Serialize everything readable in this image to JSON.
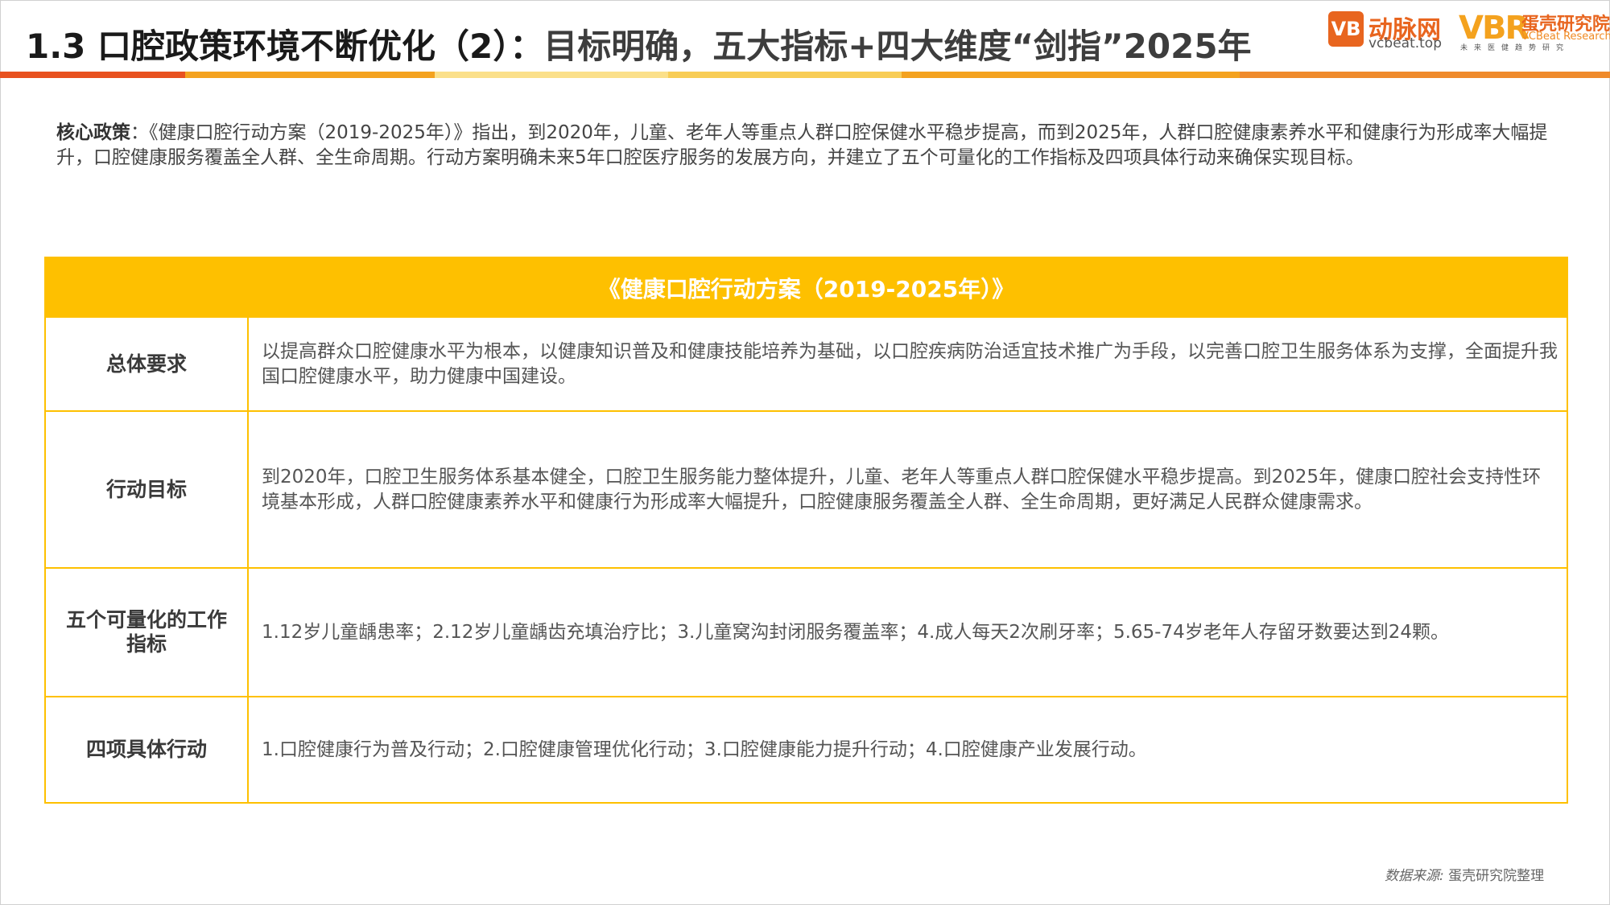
{
  "header": {
    "title_main": "1.3 口腔政策环境不断优化（2）",
    "title_sep": "：",
    "title_sub": "目标明确，五大指标+四大维度“剑指”2025年"
  },
  "logos": {
    "vb_mark": "VB",
    "dongmai_name": "动脉网",
    "dongmai_url": "vcbeat.top",
    "vbr_mark": "VBR",
    "danke_name": "蛋壳研究院",
    "danke_en": "VCBeat Research",
    "danke_slogan": "未来医健趋势研究"
  },
  "accent_colors": [
    "#e8511f",
    "#f4a21e",
    "#fbe08a",
    "#f8cd56",
    "#f4a21e",
    "#ef8a2b"
  ],
  "core_policy": {
    "label": "核心政策",
    "separator": "：",
    "text": "《健康口腔行动方案（2019-2025年）》指出，到2020年，儿童、老年人等重点人群口腔保健水平稳步提高，而到2025年，人群口腔健康素养水平和健康行为形成率大幅提升，口腔健康服务覆盖全人群、全生命周期。行动方案明确未来5年口腔医疗服务的发展方向，并建立了五个可量化的工作指标及四项具体行动来确保实现目标。"
  },
  "table": {
    "title": "《健康口腔行动方案（2019-2025年）》",
    "rows": [
      {
        "key": "总体要求",
        "value": "以提高群众口腔健康水平为根本，以健康知识普及和健康技能培养为基础，以口腔疾病防治适宜技术推广为手段，以完善口腔卫生服务体系为支撑，全面提升我国口腔健康水平，助力健康中国建设。"
      },
      {
        "key": "行动目标",
        "value": "到2020年，口腔卫生服务体系基本健全，口腔卫生服务能力整体提升，儿童、老年人等重点人群口腔保健水平稳步提高。到2025年，健康口腔社会支持性环境基本形成，人群口腔健康素养水平和健康行为形成率大幅提升，口腔健康服务覆盖全人群、全生命周期，更好满足人民群众健康需求。"
      },
      {
        "key": "五个可量化的工作指标",
        "value": "1.12岁儿童龋患率；2.12岁儿童龋齿充填治疗比；3.儿童窝沟封闭服务覆盖率；4.成人每天2次刷牙率；5.65-74岁老年人存留牙数要达到24颗。"
      },
      {
        "key": "四项具体行动",
        "value": "1.口腔健康行为普及行动；2.口腔健康管理优化行动；3.口腔健康能力提升行动；4.口腔健康产业发展行动。"
      }
    ],
    "border_color": "#fec000"
  },
  "source": {
    "label": "数据来源:",
    "text": "蛋壳研究院整理"
  }
}
